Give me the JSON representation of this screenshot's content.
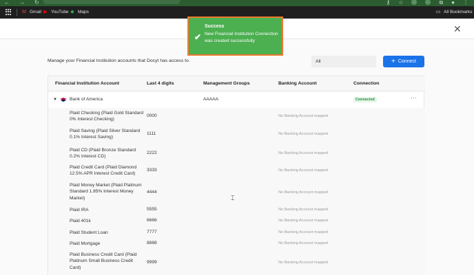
{
  "browser": {
    "bookmarks": [
      {
        "label": "Gmail",
        "icon": "gmail-icon"
      },
      {
        "label": "YouTube",
        "icon": "youtube-icon"
      },
      {
        "label": "Maps",
        "icon": "maps-icon"
      }
    ],
    "all_bookmarks_label": "All Bookmarks"
  },
  "page": {
    "intro_text": "Manage your Financial Institution accounts that Docyt has access to.",
    "filter_value": "All",
    "connect_label": "Connect",
    "close_icon": "close-icon"
  },
  "table": {
    "headers": [
      "Financial Institution Account",
      "Last 4 digits",
      "Management Groups",
      "Banking Account",
      "Connection"
    ],
    "institution": {
      "name": "Bank of America",
      "management_group": "AAAAA",
      "status": "Connected"
    },
    "accounts": [
      {
        "name": "Plaid Checking (Plaid Gold Standard 0% Interest Checking)",
        "last4": "0000",
        "banking": "No Banking Account mapped"
      },
      {
        "name": "Plaid Saving (Plaid Silver Standard 0.1% Interest Saving)",
        "last4": "1111",
        "banking": "No Banking Account mapped"
      },
      {
        "name": "Plaid CD (Plaid Bronze Standard 0.2% Interest CD)",
        "last4": "2222",
        "banking": "No Banking Account mapped"
      },
      {
        "name": "Plaid Credit Card (Plaid Diamond 12.5% APR Interest Credit Card)",
        "last4": "3333",
        "banking": "No Banking Account mapped"
      },
      {
        "name": "Plaid Money Market (Plaid Platinum Standard 1.85% Interest Money Market)",
        "last4": "4444",
        "banking": "No Banking Account mapped"
      },
      {
        "name": "Plaid IRA",
        "last4": "5555",
        "banking": "No Banking Account mapped"
      },
      {
        "name": "Plaid 401k",
        "last4": "6666",
        "banking": "No Banking Account mapped"
      },
      {
        "name": "Plaid Student Loan",
        "last4": "7777",
        "banking": "No Banking Account mapped"
      },
      {
        "name": "Plaid Mortgage",
        "last4": "8888",
        "banking": "No Banking Account mapped"
      },
      {
        "name": "Plaid Business Credit Card (Plaid Platinum Small Business Credit Card)",
        "last4": "9999",
        "banking": "No Banking Account mapped"
      }
    ]
  },
  "toast": {
    "title": "Success",
    "message": "New Financial Institution Connection was created successfully",
    "icon": "check-icon",
    "colors": {
      "background": "#4caf50",
      "border": "#ef7a2f"
    }
  },
  "colors": {
    "accent": "#1a73e8",
    "connected": "#2e8b45"
  }
}
